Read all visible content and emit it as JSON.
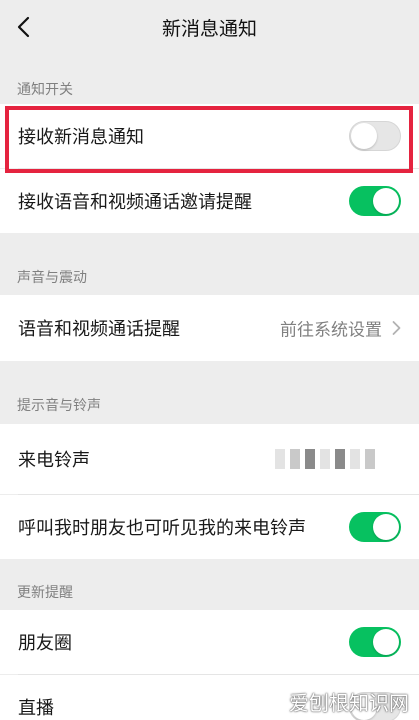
{
  "header": {
    "title": "新消息通知",
    "back_icon": "chevron-left-icon"
  },
  "sections": {
    "notify_switch": "通知开关",
    "sound_vibration": "声音与震动",
    "ringtone": "提示音与铃声",
    "update_reminder": "更新提醒"
  },
  "rows": {
    "receive_new_msg": {
      "label": "接收新消息通知",
      "enabled": false
    },
    "receive_av_invite": {
      "label": "接收语音和视频通话邀请提醒",
      "enabled": true
    },
    "av_call_reminder": {
      "label": "语音和视频通话提醒",
      "value": "前往系统设置"
    },
    "incoming_ringtone": {
      "label": "来电铃声"
    },
    "friends_hear_ringtone": {
      "label": "呼叫我时朋友也可听见我的来电铃声",
      "enabled": true
    },
    "moments": {
      "label": "朋友圈",
      "enabled": true
    },
    "live": {
      "label": "直播"
    }
  },
  "watermark": "爱刨根知识网",
  "colors": {
    "accent": "#07c160",
    "highlight": "#e5233f"
  }
}
